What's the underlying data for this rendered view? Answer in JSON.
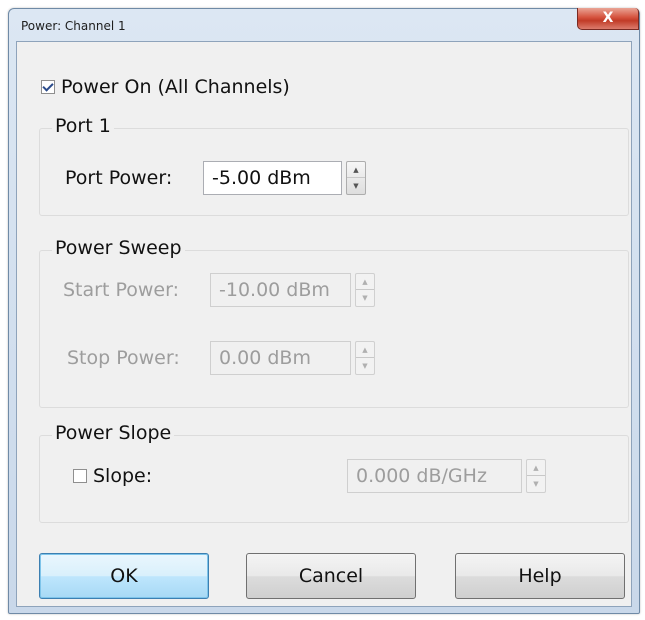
{
  "window": {
    "title": "Power: Channel 1",
    "close_glyph": "X"
  },
  "power_on": {
    "label": "Power On (All Channels)",
    "checked": true
  },
  "port1": {
    "group_title": "Port 1",
    "port_power_label": "Port Power:",
    "port_power_value": "-5.00 dBm"
  },
  "power_sweep": {
    "group_title": "Power Sweep",
    "start_label": "Start Power:",
    "start_value": "-10.00 dBm",
    "stop_label": "Stop Power:",
    "stop_value": "0.00 dBm"
  },
  "power_slope": {
    "group_title": "Power Slope",
    "slope_label": "Slope:",
    "slope_checked": false,
    "slope_value": "0.000 dB/GHz"
  },
  "buttons": {
    "ok": "OK",
    "cancel": "Cancel",
    "help": "Help"
  },
  "icons": {
    "spinner_up": "spinner-up-icon",
    "spinner_down": "spinner-down-icon",
    "close": "close-icon"
  }
}
